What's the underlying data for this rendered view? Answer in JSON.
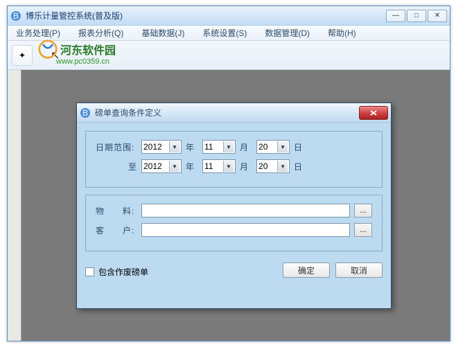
{
  "window": {
    "title": "博乐计量管控系统(普及版)",
    "minimize": "—",
    "maximize": "□",
    "close": "✕"
  },
  "menu": {
    "business": "业务处理(P)",
    "report": "报表分析(Q)",
    "basedata": "基础数据(J)",
    "settings": "系统设置(S)",
    "datamgmt": "数据管理(D)",
    "help": "帮助(H)"
  },
  "watermark": {
    "text": "河东软件园",
    "url": "www.pc0359.cn"
  },
  "dialog": {
    "title": "磅单查询条件定义",
    "date_range_label": "日期范围:",
    "to_label": "至",
    "year_suffix": "年",
    "month_suffix": "月",
    "day_suffix": "日",
    "from": {
      "year": "2012",
      "month": "11",
      "day": "20"
    },
    "to": {
      "year": "2012",
      "month": "11",
      "day": "20"
    },
    "material_label": "物　　料:",
    "customer_label": "客　　户:",
    "material_value": "",
    "customer_value": "",
    "browse": "...",
    "include_void_label": "包含作废磅单",
    "include_void": false,
    "ok": "确定",
    "cancel": "取消"
  }
}
